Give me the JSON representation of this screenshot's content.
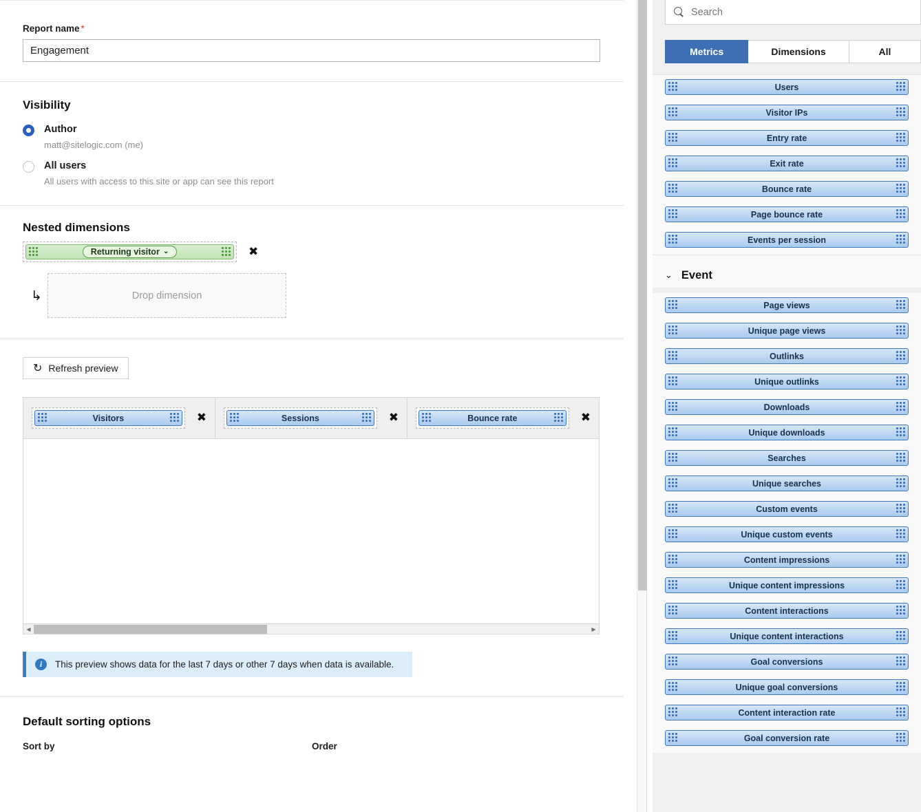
{
  "form": {
    "report_name": {
      "label": "Report name",
      "required_marker": "*",
      "value": "Engagement"
    },
    "visibility": {
      "heading": "Visibility",
      "options": [
        {
          "title": "Author",
          "subtitle": "matt@sitelogic.com (me)",
          "selected": true
        },
        {
          "title": "All users",
          "subtitle": "All users with access to this site or app can see this report",
          "selected": false
        }
      ]
    },
    "nested_dimensions": {
      "heading": "Nested dimensions",
      "dimension_chip": "Returning visitor",
      "dimension_caret": "⌄",
      "remove_label": "✖",
      "child_arrow": "↳",
      "drop_placeholder": "Drop dimension"
    },
    "preview": {
      "refresh_label": "Refresh preview",
      "refresh_icon": "refresh-icon",
      "columns": [
        {
          "label": "Visitors",
          "remove": "✖"
        },
        {
          "label": "Sessions",
          "remove": "✖"
        },
        {
          "label": "Bounce rate",
          "remove": "✖"
        }
      ],
      "scroll_left": "◀",
      "scroll_right": "▶",
      "info_icon": "i",
      "info_text": "This preview shows data for the last 7 days or other 7 days when data is available."
    },
    "sorting": {
      "heading": "Default sorting options",
      "sort_by_label": "Sort by",
      "order_label": "Order"
    }
  },
  "panel": {
    "search": {
      "placeholder": "Search",
      "icon": "search-icon"
    },
    "tabs": [
      {
        "label": "Metrics",
        "active": true
      },
      {
        "label": "Dimensions",
        "active": false
      },
      {
        "label": "All",
        "active": false
      }
    ],
    "visit_metrics": [
      "Users",
      "Visitor IPs",
      "Entry rate",
      "Exit rate",
      "Bounce rate",
      "Page bounce rate",
      "Events per session"
    ],
    "event_group": {
      "title": "Event",
      "chevron": "⌄",
      "metrics": [
        "Page views",
        "Unique page views",
        "Outlinks",
        "Unique outlinks",
        "Downloads",
        "Unique downloads",
        "Searches",
        "Unique searches",
        "Custom events",
        "Unique custom events",
        "Content impressions",
        "Unique content impressions",
        "Content interactions",
        "Unique content interactions",
        "Goal conversions",
        "Unique goal conversions",
        "Content interaction rate",
        "Goal conversion rate"
      ]
    }
  },
  "colors": {
    "accent_blue": "#3f6fb5",
    "chip_blue_border": "#3f77bd",
    "chip_green_border": "#7fbd6b",
    "info_blue": "#3b7fc4",
    "required_red": "#d23a3a"
  }
}
